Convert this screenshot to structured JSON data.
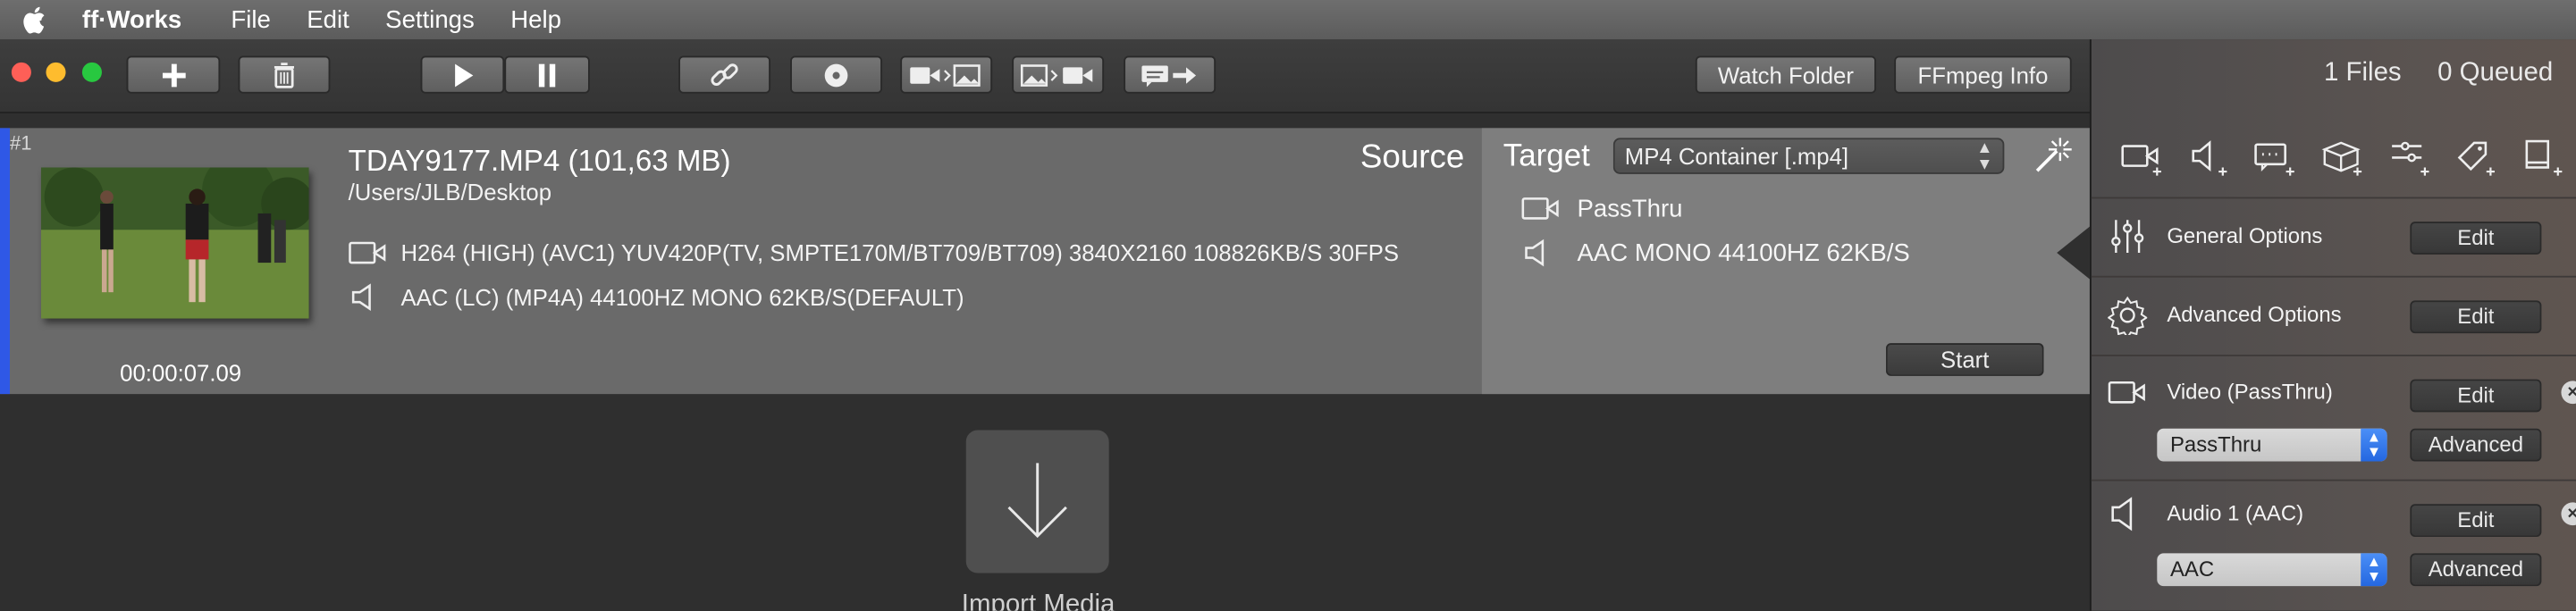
{
  "menubar": {
    "app_name": "ff·Works",
    "items": [
      "File",
      "Edit",
      "Settings",
      "Help"
    ]
  },
  "toolbar": {
    "buttons": [
      "add-icon",
      "trash-icon",
      "play-icon",
      "pause-icon",
      "link-icon",
      "disc-icon",
      "video-to-images-icon",
      "images-to-video-icon",
      "subtitle-export-icon"
    ],
    "watch_folder": "Watch Folder",
    "ffmpeg_info": "FFmpeg Info"
  },
  "status": {
    "files": "1 Files",
    "queued": "0 Queued"
  },
  "job": {
    "number": "#1",
    "title": "TDAY9177.MP4  (101,63 MB)",
    "path": "/Users/JLB/Desktop",
    "source_label": "Source",
    "video_stream": "H264 (HIGH) (AVC1)  YUV420P(TV, SMPTE170M/BT709/BT709) 3840X2160  108826KB/S 30FPS",
    "audio_stream": "AAC (LC) (MP4A) 44100HZ MONO 62KB/S(DEFAULT)",
    "duration": "00:00:07.09"
  },
  "target": {
    "label": "Target",
    "container": "MP4 Container [.mp4]",
    "video": "PassThru",
    "audio": "AAC MONO 44100HZ 62KB/S",
    "start": "Start"
  },
  "import": {
    "label": "Import Media"
  },
  "sidebar": {
    "general_options": "General Options",
    "advanced_options": "Advanced Options",
    "video_title": "Video (PassThru)",
    "video_codec": "PassThru",
    "audio_title": "Audio 1 (AAC)",
    "audio_codec": "AAC",
    "edit": "Edit",
    "advanced": "Advanced"
  },
  "colors": {
    "accent_blue": "#2f58e6",
    "close_red": "#fe5f57",
    "min_yellow": "#febc2e",
    "max_green": "#28c840"
  }
}
